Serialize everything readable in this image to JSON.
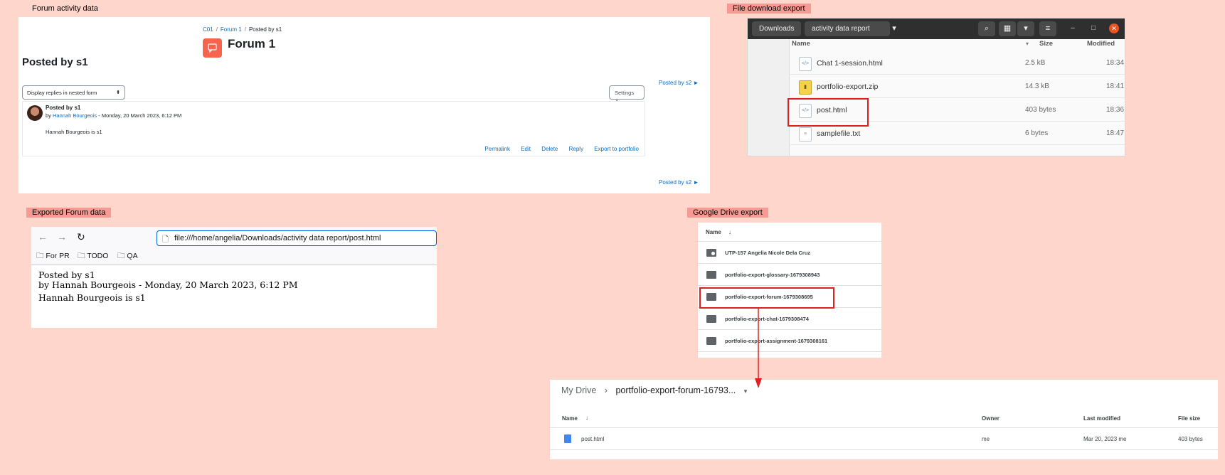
{
  "labels": {
    "forum_activity": "Forum activity data",
    "file_download": "File download export",
    "exported_forum": "Exported Forum data",
    "google_drive": "Google Drive export"
  },
  "forum": {
    "breadcrumb": [
      "C01",
      "Forum 1",
      "Posted by s1"
    ],
    "title": "Forum 1",
    "page_title": "Posted by s1",
    "next_link": "Posted by s2 ►",
    "display_mode": "Display replies in nested form",
    "settings_label": "Settings",
    "post": {
      "subject": "Posted by s1",
      "by_prefix": "by",
      "author": "Hannah Bourgeois",
      "date": "- Monday, 20 March 2023, 6:12 PM",
      "body": "Hannah Bourgeois is s1"
    },
    "actions": [
      "Permalink",
      "Edit",
      "Delete",
      "Reply",
      "Export to portfolio"
    ]
  },
  "files": {
    "path": [
      "Downloads",
      "activity data report"
    ],
    "columns": {
      "name": "Name",
      "size": "Size",
      "modified": "Modified"
    },
    "rows": [
      {
        "name": "Chat 1-session.html",
        "size": "2.5 kB",
        "modified": "18:34",
        "icon": "html-file-icon"
      },
      {
        "name": "portfolio-export.zip",
        "size": "14.3 kB",
        "modified": "18:41",
        "icon": "zip-file-icon"
      },
      {
        "name": "post.html",
        "size": "403 bytes",
        "modified": "18:36",
        "icon": "html-file-icon"
      },
      {
        "name": "samplefile.txt",
        "size": "6 bytes",
        "modified": "18:47",
        "icon": "text-file-icon"
      }
    ]
  },
  "browser": {
    "url": "file:///home/angelia/Downloads/activity data report/post.html",
    "bookmarks": [
      "For PR",
      "TODO",
      "QA"
    ],
    "content": [
      "Posted by s1",
      "by Hannah Bourgeois - Monday, 20 March 2023, 6:12 PM",
      "Hannah Bourgeois is s1"
    ]
  },
  "drive": {
    "header": "Name",
    "items": [
      "UTP-157 Angelia Nicole Dela Cruz",
      "portfolio-export-glossary-1679308943",
      "portfolio-export-forum-1679308695",
      "portfolio-export-chat-1679308474",
      "portfolio-export-assignment-1679308161"
    ]
  },
  "drive_folder": {
    "root": "My Drive",
    "current": "portfolio-export-forum-16793...",
    "columns": {
      "name": "Name",
      "owner": "Owner",
      "modified": "Last modified",
      "size": "File size"
    },
    "file": {
      "name": "post.html",
      "owner": "me",
      "modified": "Mar 20, 2023 me",
      "size": "403 bytes"
    }
  },
  "colors": {
    "background": "#ffd6cc",
    "label_highlight": "#f79a94",
    "link": "#0f6cbf",
    "forum_icon": "#f7634d",
    "annotation": "#e02020"
  }
}
